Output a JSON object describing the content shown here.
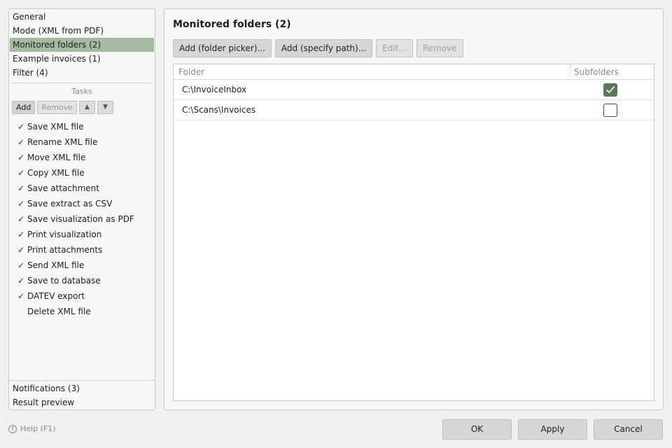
{
  "nav": {
    "top_items": [
      {
        "label": "General",
        "selected": false
      },
      {
        "label": "Mode (XML from PDF)",
        "selected": false
      },
      {
        "label": "Monitored folders (2)",
        "selected": true
      },
      {
        "label": "Example invoices (1)",
        "selected": false
      },
      {
        "label": "Filter (4)",
        "selected": false
      }
    ],
    "bottom_items": [
      {
        "label": "Notifications (3)"
      },
      {
        "label": "Result preview"
      }
    ]
  },
  "tasks": {
    "title": "Tasks",
    "add_label": "Add",
    "remove_label": "Remove",
    "up_icon": "▲",
    "down_icon": "▼",
    "items": [
      {
        "label": "Save XML file",
        "mark": "✓"
      },
      {
        "label": "Rename XML file",
        "mark": "✓"
      },
      {
        "label": "Move XML file",
        "mark": "✓"
      },
      {
        "label": "Copy XML file",
        "mark": "✓"
      },
      {
        "label": "Save attachment",
        "mark": "✓"
      },
      {
        "label": "Save extract as CSV",
        "mark": "✓"
      },
      {
        "label": "Save visualization as PDF",
        "mark": "✓"
      },
      {
        "label": "Print visualization",
        "mark": "✓"
      },
      {
        "label": "Print attachments",
        "mark": "✓"
      },
      {
        "label": "Send XML file",
        "mark": "✓"
      },
      {
        "label": "Save to database",
        "mark": "✓"
      },
      {
        "label": "DATEV export",
        "mark": "✓"
      },
      {
        "label": "Delete XML file",
        "mark": ""
      }
    ]
  },
  "main": {
    "title": "Monitored folders (2)",
    "buttons": {
      "add_picker": "Add (folder picker)...",
      "add_path": "Add (specify path)...",
      "edit": "Edit...",
      "remove": "Remove"
    },
    "table": {
      "columns": [
        "Folder",
        "Subfolders"
      ],
      "rows": [
        {
          "folder": "C:\\InvoiceInbox",
          "subfolders": true
        },
        {
          "folder": "C:\\Scans\\Invoices",
          "subfolders": false
        }
      ]
    }
  },
  "footer": {
    "help_label": "Help (F1)",
    "help_icon": "!",
    "ok_label": "OK",
    "apply_label": "Apply",
    "cancel_label": "Cancel"
  },
  "colors": {
    "selected_bg": "#a4bb9f",
    "checkbox_checked": "#59795a"
  }
}
